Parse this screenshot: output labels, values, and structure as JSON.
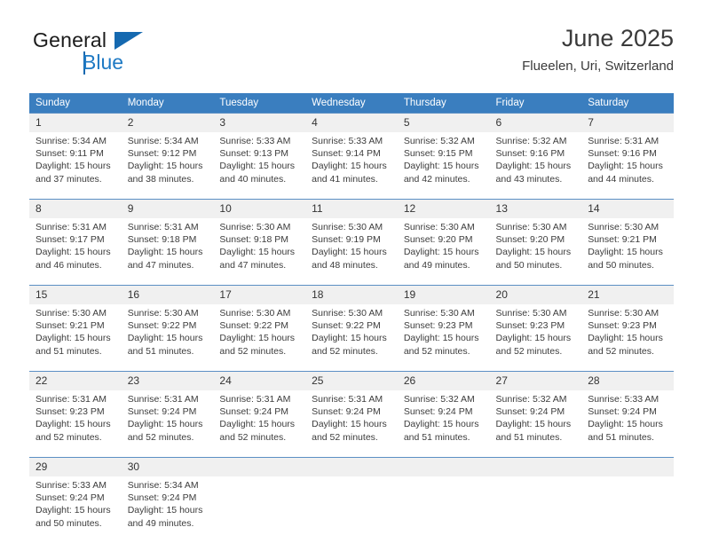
{
  "brand": {
    "name_primary": "General",
    "name_secondary": "Blue",
    "triangle_color": "#1569b0",
    "secondary_color": "#1f7ac4"
  },
  "header": {
    "title": "June 2025",
    "subtitle": "Flueelen, Uri, Switzerland"
  },
  "theme": {
    "header_blue": "#3a7ebf",
    "daynum_band": "#f0f0f0",
    "row_border": "#5b8fc4",
    "text": "#3c3c3c"
  },
  "weekday_headers": [
    "Sunday",
    "Monday",
    "Tuesday",
    "Wednesday",
    "Thursday",
    "Friday",
    "Saturday"
  ],
  "labels": {
    "sunrise_prefix": "Sunrise:",
    "sunset_prefix": "Sunset:",
    "daylight_prefix": "Daylight:"
  },
  "weeks": [
    [
      {
        "day": "1",
        "sunrise": "Sunrise: 5:34 AM",
        "sunset": "Sunset: 9:11 PM",
        "daylight_1": "Daylight: 15 hours",
        "daylight_2": "and 37 minutes."
      },
      {
        "day": "2",
        "sunrise": "Sunrise: 5:34 AM",
        "sunset": "Sunset: 9:12 PM",
        "daylight_1": "Daylight: 15 hours",
        "daylight_2": "and 38 minutes."
      },
      {
        "day": "3",
        "sunrise": "Sunrise: 5:33 AM",
        "sunset": "Sunset: 9:13 PM",
        "daylight_1": "Daylight: 15 hours",
        "daylight_2": "and 40 minutes."
      },
      {
        "day": "4",
        "sunrise": "Sunrise: 5:33 AM",
        "sunset": "Sunset: 9:14 PM",
        "daylight_1": "Daylight: 15 hours",
        "daylight_2": "and 41 minutes."
      },
      {
        "day": "5",
        "sunrise": "Sunrise: 5:32 AM",
        "sunset": "Sunset: 9:15 PM",
        "daylight_1": "Daylight: 15 hours",
        "daylight_2": "and 42 minutes."
      },
      {
        "day": "6",
        "sunrise": "Sunrise: 5:32 AM",
        "sunset": "Sunset: 9:16 PM",
        "daylight_1": "Daylight: 15 hours",
        "daylight_2": "and 43 minutes."
      },
      {
        "day": "7",
        "sunrise": "Sunrise: 5:31 AM",
        "sunset": "Sunset: 9:16 PM",
        "daylight_1": "Daylight: 15 hours",
        "daylight_2": "and 44 minutes."
      }
    ],
    [
      {
        "day": "8",
        "sunrise": "Sunrise: 5:31 AM",
        "sunset": "Sunset: 9:17 PM",
        "daylight_1": "Daylight: 15 hours",
        "daylight_2": "and 46 minutes."
      },
      {
        "day": "9",
        "sunrise": "Sunrise: 5:31 AM",
        "sunset": "Sunset: 9:18 PM",
        "daylight_1": "Daylight: 15 hours",
        "daylight_2": "and 47 minutes."
      },
      {
        "day": "10",
        "sunrise": "Sunrise: 5:30 AM",
        "sunset": "Sunset: 9:18 PM",
        "daylight_1": "Daylight: 15 hours",
        "daylight_2": "and 47 minutes."
      },
      {
        "day": "11",
        "sunrise": "Sunrise: 5:30 AM",
        "sunset": "Sunset: 9:19 PM",
        "daylight_1": "Daylight: 15 hours",
        "daylight_2": "and 48 minutes."
      },
      {
        "day": "12",
        "sunrise": "Sunrise: 5:30 AM",
        "sunset": "Sunset: 9:20 PM",
        "daylight_1": "Daylight: 15 hours",
        "daylight_2": "and 49 minutes."
      },
      {
        "day": "13",
        "sunrise": "Sunrise: 5:30 AM",
        "sunset": "Sunset: 9:20 PM",
        "daylight_1": "Daylight: 15 hours",
        "daylight_2": "and 50 minutes."
      },
      {
        "day": "14",
        "sunrise": "Sunrise: 5:30 AM",
        "sunset": "Sunset: 9:21 PM",
        "daylight_1": "Daylight: 15 hours",
        "daylight_2": "and 50 minutes."
      }
    ],
    [
      {
        "day": "15",
        "sunrise": "Sunrise: 5:30 AM",
        "sunset": "Sunset: 9:21 PM",
        "daylight_1": "Daylight: 15 hours",
        "daylight_2": "and 51 minutes."
      },
      {
        "day": "16",
        "sunrise": "Sunrise: 5:30 AM",
        "sunset": "Sunset: 9:22 PM",
        "daylight_1": "Daylight: 15 hours",
        "daylight_2": "and 51 minutes."
      },
      {
        "day": "17",
        "sunrise": "Sunrise: 5:30 AM",
        "sunset": "Sunset: 9:22 PM",
        "daylight_1": "Daylight: 15 hours",
        "daylight_2": "and 52 minutes."
      },
      {
        "day": "18",
        "sunrise": "Sunrise: 5:30 AM",
        "sunset": "Sunset: 9:22 PM",
        "daylight_1": "Daylight: 15 hours",
        "daylight_2": "and 52 minutes."
      },
      {
        "day": "19",
        "sunrise": "Sunrise: 5:30 AM",
        "sunset": "Sunset: 9:23 PM",
        "daylight_1": "Daylight: 15 hours",
        "daylight_2": "and 52 minutes."
      },
      {
        "day": "20",
        "sunrise": "Sunrise: 5:30 AM",
        "sunset": "Sunset: 9:23 PM",
        "daylight_1": "Daylight: 15 hours",
        "daylight_2": "and 52 minutes."
      },
      {
        "day": "21",
        "sunrise": "Sunrise: 5:30 AM",
        "sunset": "Sunset: 9:23 PM",
        "daylight_1": "Daylight: 15 hours",
        "daylight_2": "and 52 minutes."
      }
    ],
    [
      {
        "day": "22",
        "sunrise": "Sunrise: 5:31 AM",
        "sunset": "Sunset: 9:23 PM",
        "daylight_1": "Daylight: 15 hours",
        "daylight_2": "and 52 minutes."
      },
      {
        "day": "23",
        "sunrise": "Sunrise: 5:31 AM",
        "sunset": "Sunset: 9:24 PM",
        "daylight_1": "Daylight: 15 hours",
        "daylight_2": "and 52 minutes."
      },
      {
        "day": "24",
        "sunrise": "Sunrise: 5:31 AM",
        "sunset": "Sunset: 9:24 PM",
        "daylight_1": "Daylight: 15 hours",
        "daylight_2": "and 52 minutes."
      },
      {
        "day": "25",
        "sunrise": "Sunrise: 5:31 AM",
        "sunset": "Sunset: 9:24 PM",
        "daylight_1": "Daylight: 15 hours",
        "daylight_2": "and 52 minutes."
      },
      {
        "day": "26",
        "sunrise": "Sunrise: 5:32 AM",
        "sunset": "Sunset: 9:24 PM",
        "daylight_1": "Daylight: 15 hours",
        "daylight_2": "and 51 minutes."
      },
      {
        "day": "27",
        "sunrise": "Sunrise: 5:32 AM",
        "sunset": "Sunset: 9:24 PM",
        "daylight_1": "Daylight: 15 hours",
        "daylight_2": "and 51 minutes."
      },
      {
        "day": "28",
        "sunrise": "Sunrise: 5:33 AM",
        "sunset": "Sunset: 9:24 PM",
        "daylight_1": "Daylight: 15 hours",
        "daylight_2": "and 51 minutes."
      }
    ],
    [
      {
        "day": "29",
        "sunrise": "Sunrise: 5:33 AM",
        "sunset": "Sunset: 9:24 PM",
        "daylight_1": "Daylight: 15 hours",
        "daylight_2": "and 50 minutes."
      },
      {
        "day": "30",
        "sunrise": "Sunrise: 5:34 AM",
        "sunset": "Sunset: 9:24 PM",
        "daylight_1": "Daylight: 15 hours",
        "daylight_2": "and 49 minutes."
      },
      {
        "day": "",
        "sunrise": "",
        "sunset": "",
        "daylight_1": "",
        "daylight_2": ""
      },
      {
        "day": "",
        "sunrise": "",
        "sunset": "",
        "daylight_1": "",
        "daylight_2": ""
      },
      {
        "day": "",
        "sunrise": "",
        "sunset": "",
        "daylight_1": "",
        "daylight_2": ""
      },
      {
        "day": "",
        "sunrise": "",
        "sunset": "",
        "daylight_1": "",
        "daylight_2": ""
      },
      {
        "day": "",
        "sunrise": "",
        "sunset": "",
        "daylight_1": "",
        "daylight_2": ""
      }
    ]
  ]
}
